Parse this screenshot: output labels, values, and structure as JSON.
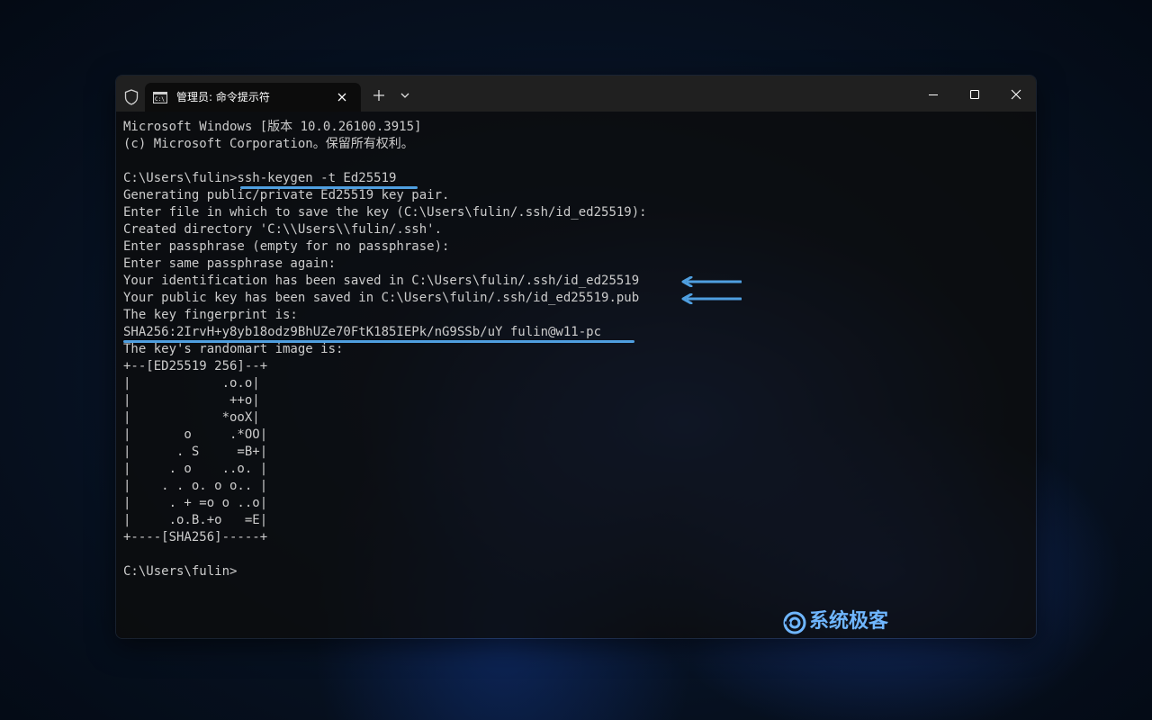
{
  "window": {
    "tab_title": "管理员: 命令提示符",
    "tab_icon": "cmd-icon",
    "close_tab_icon": "close-icon",
    "new_tab_icon": "plus-icon",
    "dropdown_icon": "chevron-down-icon",
    "admin_icon": "shield-icon",
    "minimize_icon": "minimize-icon",
    "maximize_icon": "maximize-icon",
    "close_icon": "close-icon"
  },
  "terminal": {
    "lines": [
      "Microsoft Windows [版本 10.0.26100.3915]",
      "(c) Microsoft Corporation。保留所有权利。",
      "",
      "C:\\Users\\fulin>ssh-keygen -t Ed25519",
      "Generating public/private Ed25519 key pair.",
      "Enter file in which to save the key (C:\\Users\\fulin/.ssh/id_ed25519):",
      "Created directory 'C:\\\\Users\\\\fulin/.ssh'.",
      "Enter passphrase (empty for no passphrase):",
      "Enter same passphrase again:",
      "Your identification has been saved in C:\\Users\\fulin/.ssh/id_ed25519",
      "Your public key has been saved in C:\\Users\\fulin/.ssh/id_ed25519.pub",
      "The key fingerprint is:",
      "SHA256:2IrvH+y8yb18odz9BhUZe70FtK185IEPk/nG9SSb/uY fulin@w11-pc",
      "The key's randomart image is:",
      "+--[ED25519 256]--+",
      "|            .o.o|",
      "|             ++o|",
      "|            *ooX|",
      "|       o     .*OO|",
      "|      . S     =B+|",
      "|     . o    ..o. |",
      "|    . . o. o o.. |",
      "|     . + =o o ..o|",
      "|     .o.B.+o   =E|",
      "+----[SHA256]-----+",
      "",
      "C:\\Users\\fulin>"
    ]
  },
  "watermark": {
    "text": "系统极客",
    "icon": "logo-icon"
  },
  "colors": {
    "accent": "#4f9fe0",
    "terminal_text": "#cccccc"
  }
}
